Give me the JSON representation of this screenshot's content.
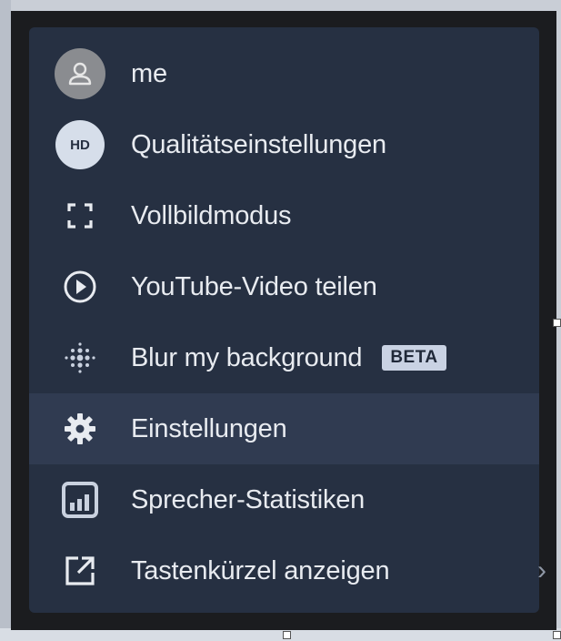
{
  "menu": {
    "items": [
      {
        "label": "me",
        "icon": "user-avatar-icon"
      },
      {
        "label": "Qualitätseinstellungen",
        "icon": "hd-quality-icon",
        "icon_text": "HD"
      },
      {
        "label": "Vollbildmodus",
        "icon": "fullscreen-icon"
      },
      {
        "label": "YouTube-Video teilen",
        "icon": "play-circle-icon"
      },
      {
        "label": "Blur my background",
        "icon": "blur-dots-icon",
        "badge": "BETA"
      },
      {
        "label": "Einstellungen",
        "icon": "gear-icon",
        "highlighted": true
      },
      {
        "label": "Sprecher-Statistiken",
        "icon": "bar-chart-icon"
      },
      {
        "label": "Tastenkürzel anzeigen",
        "icon": "external-link-icon",
        "has_submenu": true
      }
    ]
  },
  "submenu_arrow": "›",
  "colors": {
    "menu_bg": "#263042",
    "highlight_bg": "#303b51",
    "text": "#e8ebf0",
    "badge_bg": "#c9d2e3"
  }
}
